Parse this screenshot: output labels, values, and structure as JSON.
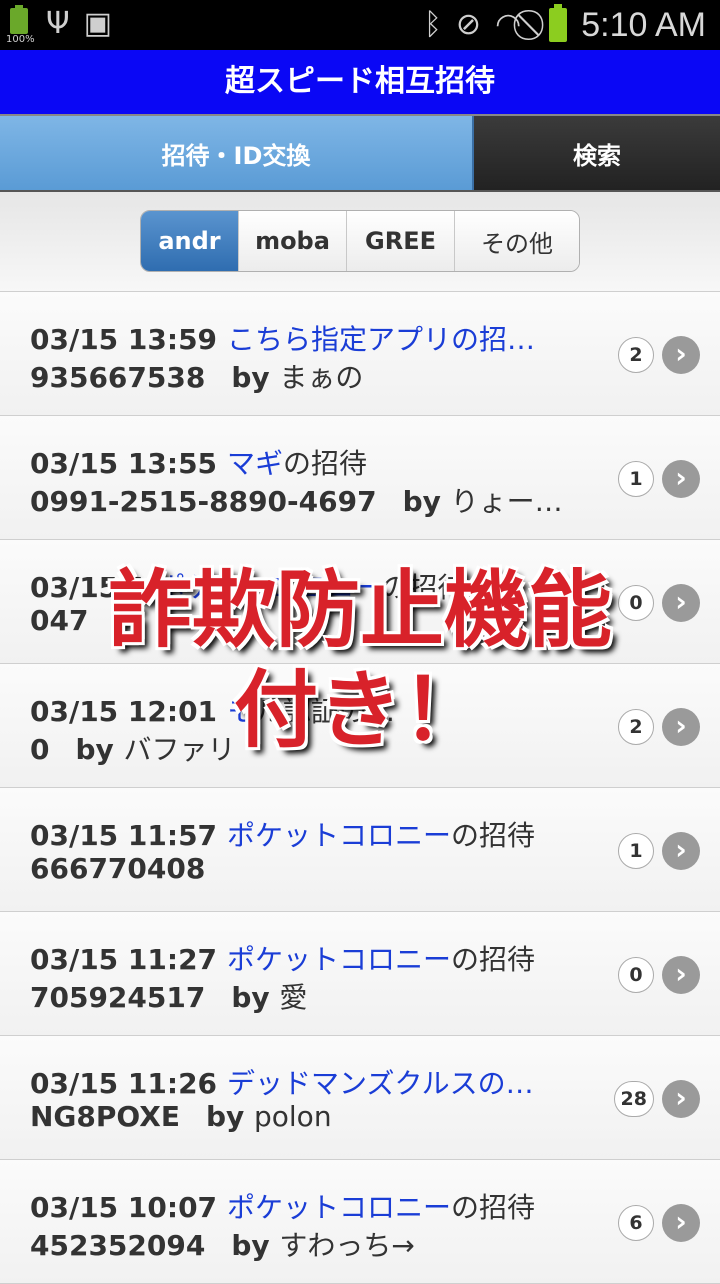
{
  "status_bar": {
    "battery_small_pct": "100%",
    "time": "5:10 AM",
    "icons": [
      "battery-icon",
      "usb-icon",
      "sd-card-icon",
      "bluetooth-icon",
      "mute-icon",
      "wifi-icon",
      "no-signal-icon",
      "battery-icon"
    ]
  },
  "app": {
    "title": "超スピード相互招待"
  },
  "tabs": [
    {
      "label": "招待・ID交換",
      "active": true
    },
    {
      "label": "検索",
      "active": false
    }
  ],
  "segments": [
    {
      "label": "andr",
      "active": true
    },
    {
      "label": "moba",
      "active": false
    },
    {
      "label": "GREE",
      "active": false
    },
    {
      "label": "その他",
      "active": false
    }
  ],
  "list": [
    {
      "date": "03/15 13:59",
      "app": "こちら指定アプリの招…",
      "suffix": "",
      "code": "935667538",
      "by": "by",
      "user": "まぁの",
      "count": "2"
    },
    {
      "date": "03/15 13:55",
      "app": "マギ",
      "suffix": "の招待",
      "code": "0991-2515-8890-4697",
      "by": "by",
      "user": "りょー…",
      "count": "1"
    },
    {
      "date": "03/15 1",
      "app": "ポケットコロニー",
      "suffix": "の招待",
      "code": "047",
      "by": "",
      "user": "",
      "count": "0"
    },
    {
      "date": "03/15 12:01",
      "app": "モ",
      "suffix": "ル認証の…",
      "code": "0",
      "by": "by",
      "user": "バファリ",
      "count": "2"
    },
    {
      "date": "03/15 11:57",
      "app": "ポケットコロニー",
      "suffix": "の招待",
      "code": "666770408",
      "by": "",
      "user": "",
      "count": "1"
    },
    {
      "date": "03/15 11:27",
      "app": "ポケットコロニー",
      "suffix": "の招待",
      "code": "705924517",
      "by": "by",
      "user": "愛",
      "count": "0"
    },
    {
      "date": "03/15 11:26",
      "app": "デッドマンズクルスの…",
      "suffix": "",
      "code": "NG8POXE",
      "by": "by",
      "user": "polon",
      "count": "28"
    },
    {
      "date": "03/15 10:07",
      "app": "ポケットコロニー",
      "suffix": "の招待",
      "code": "452352094",
      "by": "by",
      "user": "すわっち→",
      "count": "6"
    }
  ],
  "overlay": {
    "line1": "詐欺防止機能",
    "line2": "付き！"
  },
  "colors": {
    "title_bar": "#0a07f5",
    "tab_active": "#5a9bd5",
    "segment_active": "#2f6db0",
    "app_link": "#1a3dd6",
    "overlay_text": "#d8222a"
  }
}
